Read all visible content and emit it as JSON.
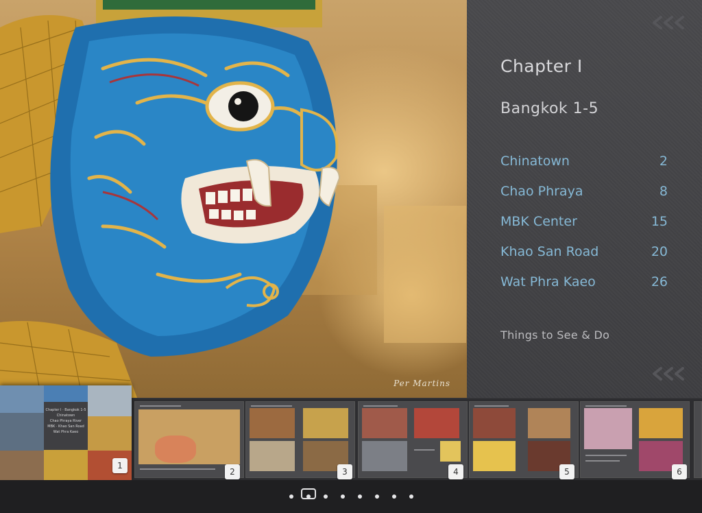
{
  "hero": {
    "signature": "Per Martins"
  },
  "panel": {
    "chapter_title": "Chapter I",
    "chapter_subtitle": "Bangkok 1-5",
    "toc": [
      {
        "label": "Chinatown",
        "page": "2"
      },
      {
        "label": "Chao Phraya",
        "page": "8"
      },
      {
        "label": "MBK Center",
        "page": "15"
      },
      {
        "label": "Khao San Road",
        "page": "20"
      },
      {
        "label": "Wat Phra Kaeo",
        "page": "26"
      }
    ],
    "extra_link": "Things to See & Do",
    "accent_color": "#86b9d6"
  },
  "filmstrip": {
    "active_caption": [
      "Chapter I · Bangkok 1-5",
      "Chinatown",
      "Chao Phraya River",
      "MBK · Khao San Road",
      "Wat Phra Kaeo"
    ],
    "page_numbers": [
      "1",
      "2",
      "3",
      "4",
      "5",
      "6"
    ]
  },
  "pager": {
    "total": 8,
    "current": 2
  }
}
